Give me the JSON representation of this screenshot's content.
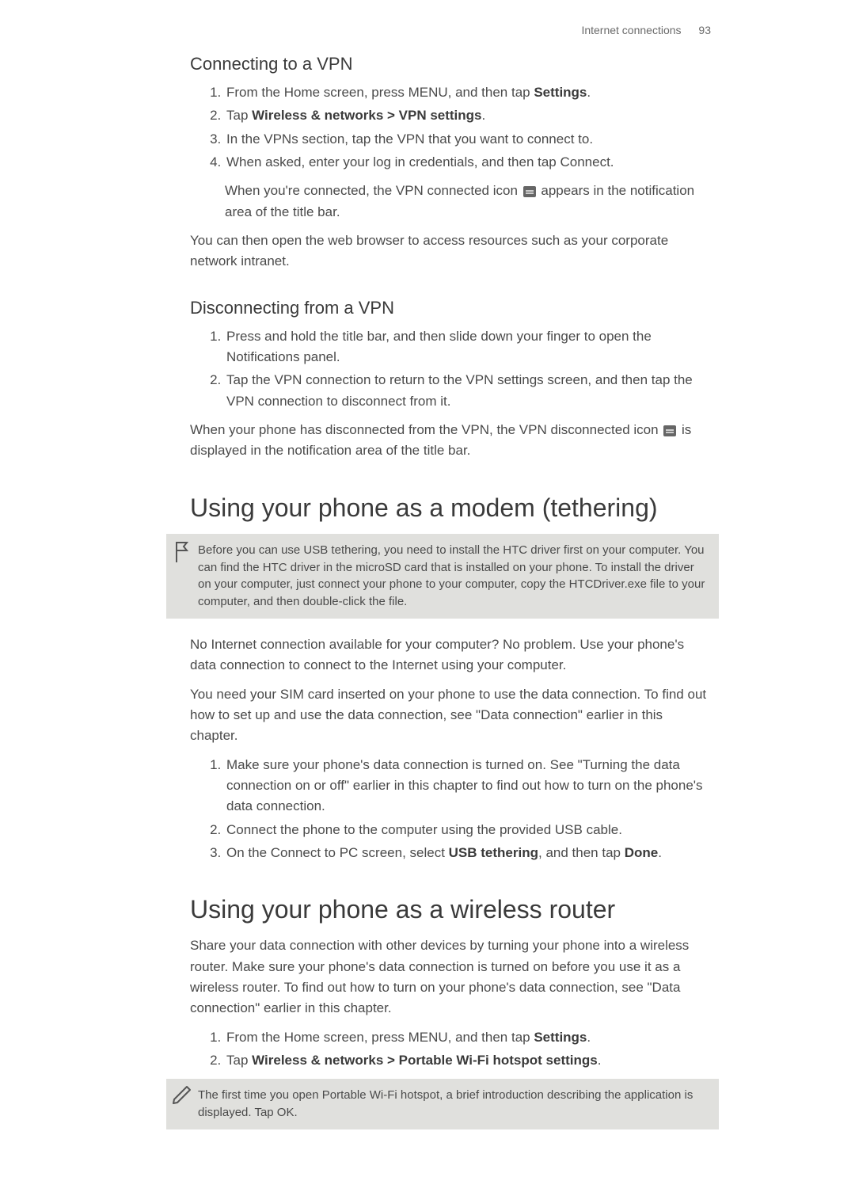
{
  "header": {
    "section": "Internet connections",
    "page": "93"
  },
  "s1": {
    "title": "Connecting to a VPN",
    "items": [
      {
        "pre": "From the Home screen, press MENU, and then tap ",
        "b1": "Settings",
        "post": "."
      },
      {
        "pre": "Tap ",
        "b1": "Wireless & networks > VPN settings",
        "post": "."
      },
      {
        "pre": "In the VPNs section, tap the VPN that you want to connect to."
      },
      {
        "pre": "When asked, enter your log in credentials, and then tap Connect."
      }
    ],
    "cont_pre": "When you're connected, the VPN connected icon ",
    "cont_post": " appears in the notification area of the title bar.",
    "tail": "You can then open the web browser to access resources such as your corporate network intranet."
  },
  "s2": {
    "title": "Disconnecting from a VPN",
    "items": [
      "Press and hold the title bar, and then slide down your finger to open the Notifications panel.",
      "Tap the VPN connection to return to the VPN settings screen, and then tap the VPN connection to disconnect from it."
    ],
    "tail_pre": "When your phone has disconnected from the VPN, the VPN disconnected icon ",
    "tail_post": " is displayed in the notification area of the title bar."
  },
  "s3": {
    "title": "Using your phone as a modem (tethering)",
    "note": "Before you can use USB tethering, you need to install the HTC driver first on your computer. You can find the HTC driver in the microSD card that is installed on your phone. To install the driver on your computer, just connect your phone to your computer, copy the HTCDriver.exe file to your computer, and then double-click the file.",
    "p1": "No Internet connection available for your computer? No problem. Use your phone's data connection to connect to the Internet using your computer.",
    "p2": "You need your SIM card inserted on your phone to use the data connection. To find out how to set up and use the data connection, see \"Data connection\" earlier in this chapter.",
    "items": [
      {
        "pre": "Make sure your phone's data connection is turned on. See \"Turning the data connection on or off\" earlier in this chapter to find out how to turn on the phone's data connection."
      },
      {
        "pre": "Connect the phone to the computer using the provided USB cable."
      },
      {
        "pre": "On the Connect to PC screen, select ",
        "b1": "USB tethering",
        "mid": ", and then tap ",
        "b2": "Done",
        "post": "."
      }
    ]
  },
  "s4": {
    "title": "Using your phone as a wireless router",
    "p1": "Share your data connection with other devices by turning your phone into a wireless router. Make sure your phone's data connection is turned on before you use it as a wireless router. To find out how to turn on your phone's data connection, see \"Data connection\" earlier in this chapter.",
    "items": [
      {
        "pre": "From the Home screen, press MENU, and then tap ",
        "b1": "Settings",
        "post": "."
      },
      {
        "pre": "Tap ",
        "b1": "Wireless & networks > Portable Wi-Fi hotspot settings",
        "post": "."
      }
    ],
    "note": "The first time you open Portable Wi-Fi hotspot, a brief introduction describing the application is displayed. Tap OK."
  }
}
